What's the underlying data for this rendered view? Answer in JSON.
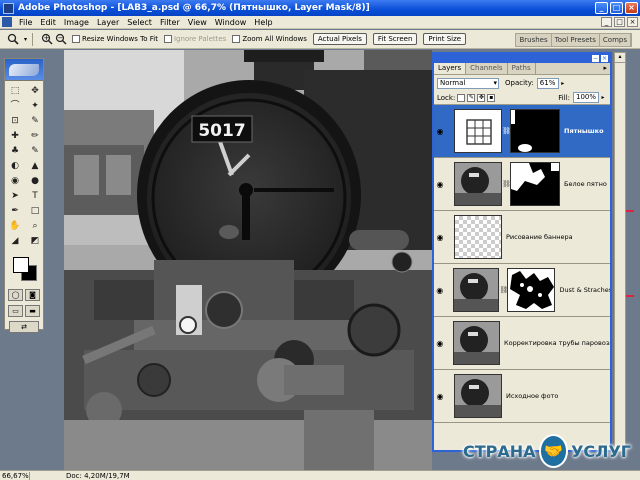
{
  "window": {
    "title": "Adobe Photoshop - [LAB3_a.psd @ 66,7% (Пятнышко, Layer Mask/8)]",
    "minimize": "_",
    "maximize": "□",
    "close": "×"
  },
  "menu": [
    "File",
    "Edit",
    "Image",
    "Layer",
    "Select",
    "Filter",
    "View",
    "Window",
    "Help"
  ],
  "doc_controls": [
    "_",
    "□",
    "×"
  ],
  "options_bar": {
    "zoom_in": "+",
    "zoom_out": "−",
    "resize_windows_label": "Resize Windows To Fit",
    "ignore_palettes_label": "Ignore Palettes",
    "zoom_all_label": "Zoom All Windows",
    "actual_pixels": "Actual Pixels",
    "fit_screen": "Fit Screen",
    "print_size": "Print Size",
    "palette_well": [
      "Brushes",
      "Tool Presets",
      "Comps"
    ]
  },
  "toolbox": {
    "tools": [
      "⬚",
      "✥",
      "⌒",
      "✦",
      "⊡",
      "✎",
      "✚",
      "✏",
      "♣",
      "✎",
      "◐",
      "▲",
      "◉",
      "●",
      "➤",
      "T",
      "✒",
      "□",
      "✋",
      "⌕",
      "◢",
      "◩"
    ],
    "mode_buttons": [
      "◯",
      "◙"
    ],
    "screen_buttons": [
      "▭",
      "▬"
    ],
    "jump_button": "⇄"
  },
  "canvas": {
    "engine_number": "5017"
  },
  "layers_panel": {
    "tabs": [
      "Layers",
      "Channels",
      "Paths"
    ],
    "blend_mode": "Normal",
    "opacity_label": "Opacity:",
    "opacity_value": "61%",
    "lock_label": "Lock:",
    "fill_label": "Fill:",
    "fill_value": "100%",
    "layers": [
      {
        "name": "Пятнышко",
        "selected": true,
        "has_mask": true
      },
      {
        "name": "Белое пятно",
        "selected": false,
        "has_mask": true
      },
      {
        "name": "Рисование баннера",
        "selected": false,
        "has_mask": false
      },
      {
        "name": "Dust & Straches",
        "selected": false,
        "has_mask": true
      },
      {
        "name": "Корректировка трубы паровоза",
        "selected": false,
        "has_mask": false
      },
      {
        "name": "Исходное фото",
        "selected": false,
        "has_mask": false
      }
    ]
  },
  "status_bar": {
    "zoom": "66,67%",
    "doc": "Doc: 4,20M/19,7M"
  },
  "watermark": {
    "left_word": "СТРАНА",
    "right_word": "УСЛУГ"
  }
}
